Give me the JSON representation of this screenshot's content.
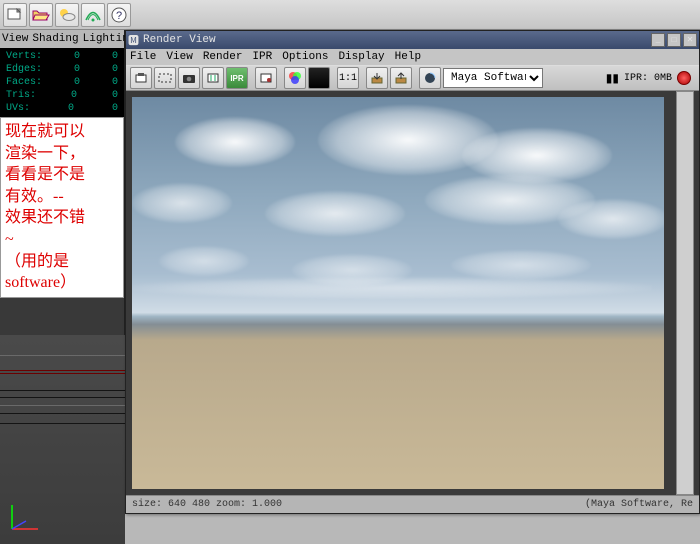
{
  "app_name": "Maya",
  "main_toolbar_icons": [
    "new-scene",
    "open-scene",
    "weather",
    "radar",
    "help"
  ],
  "left_menu": {
    "items": [
      "View",
      "Shading",
      "Lighting"
    ]
  },
  "stats": [
    {
      "label": "Verts:",
      "value": "0",
      "value2": "0"
    },
    {
      "label": "Edges:",
      "value": "0",
      "value2": "0"
    },
    {
      "label": "Faces:",
      "value": "0",
      "value2": "0"
    },
    {
      "label": "Tris:",
      "value": "0",
      "value2": "0"
    },
    {
      "label": "UVs:",
      "value": "0",
      "value2": "0"
    }
  ],
  "annotation": {
    "line1": "现在就可以",
    "line2": "渲染一下，",
    "line3": "看看是不是",
    "line4": "有效。--",
    "line5": "效果还不错",
    "line6": "~",
    "line7": "（用的是",
    "line8": "software）"
  },
  "render_view": {
    "title": "Render View",
    "menu": [
      "File",
      "View",
      "Render",
      "IPR",
      "Options",
      "Display",
      "Help"
    ],
    "ratio": "1:1",
    "renderer_selected": "Maya Software",
    "ipr_label": "IPR: 0MB",
    "status_left": "size:  640  480 zoom: 1.000",
    "status_right": "(Maya Software, Re"
  }
}
